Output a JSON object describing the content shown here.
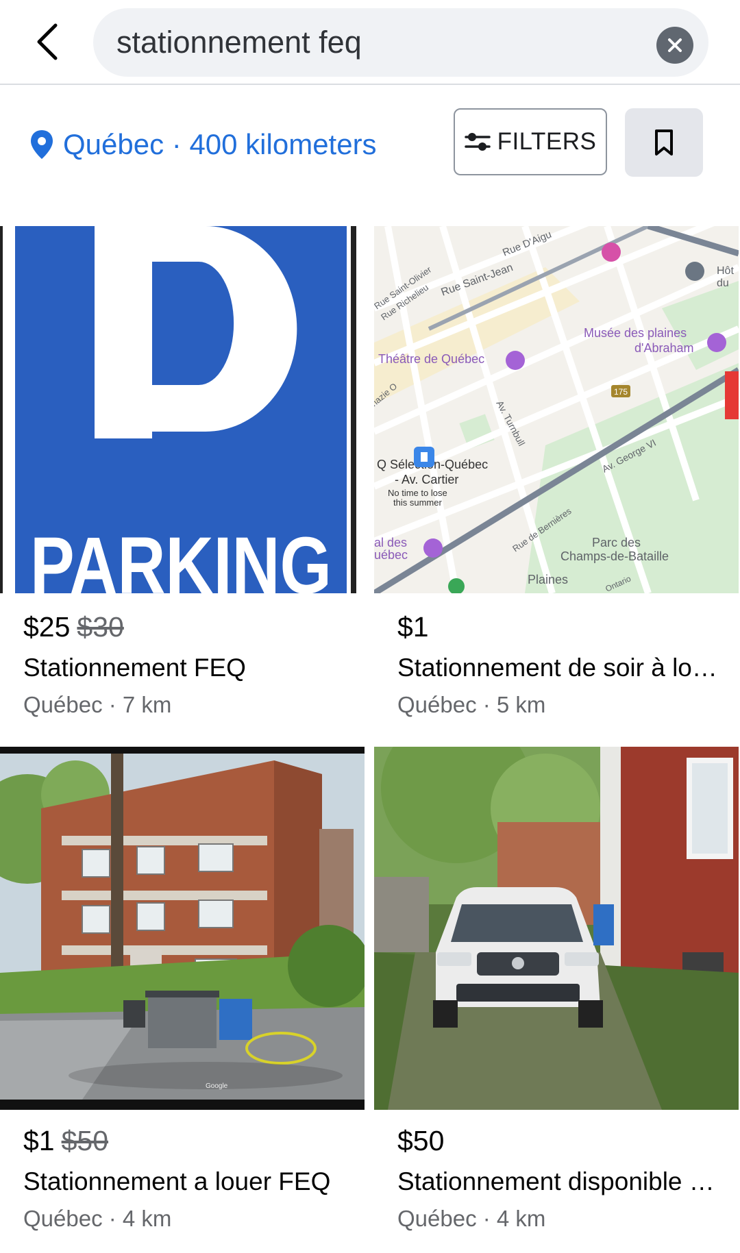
{
  "search": {
    "query": "stationnement feq"
  },
  "location": {
    "city": "Québec",
    "separator": " · ",
    "radius": "400 kilometers"
  },
  "toolbar": {
    "filters_label": "FILTERS"
  },
  "listings": [
    {
      "price": "$25",
      "old_price": "$30",
      "title": "Stationnement FEQ",
      "location": "Québec · 7 km",
      "image_text": "PARKING"
    },
    {
      "price": "$1",
      "old_price": "",
      "title": "Stationnement de soir à louer…",
      "location": "Québec · 5 km",
      "map_labels": {
        "rue_saint_jean": "Rue Saint-Jean",
        "rue_d_aig": "Rue D'Aigu",
        "rue_saint_olivier": "Rue Saint-Olivier",
        "rue_richelieu": "Rue Richelieu",
        "theatre": "Théâtre de Québec",
        "musee_1": "Musée des plaines",
        "musee_2": "d'Abraham",
        "turnbull": "Av. Turnbull",
        "george": "Av. George VI",
        "selection_1": "Q Sélection-Québec",
        "selection_2": "- Av. Cartier",
        "notime_1": "No time to lose",
        "notime_2": "this summer",
        "bernieres": "Rue de Bernières",
        "parc_1": "Parc des",
        "parc_2": "Champs-de-Bataille",
        "plaines": "Plaines",
        "route": "175",
        "hotel": "Hôt",
        "hotel2": "du",
        "ontario": "Ontario",
        "nazie": "nazie O",
        "al_des": "al des",
        "uebec": "uébec"
      }
    },
    {
      "price": "$1",
      "old_price": "$50",
      "title": "Stationnement a louer FEQ",
      "location": "Québec · 4 km",
      "watermark": "Google"
    },
    {
      "price": "$50",
      "old_price": "",
      "title": "Stationnement disponible po…",
      "location": "Québec · 4 km"
    }
  ],
  "colors": {
    "accent": "#216fdb",
    "parking_blue": "#2a5fbf",
    "map_road": "#7a8595"
  }
}
